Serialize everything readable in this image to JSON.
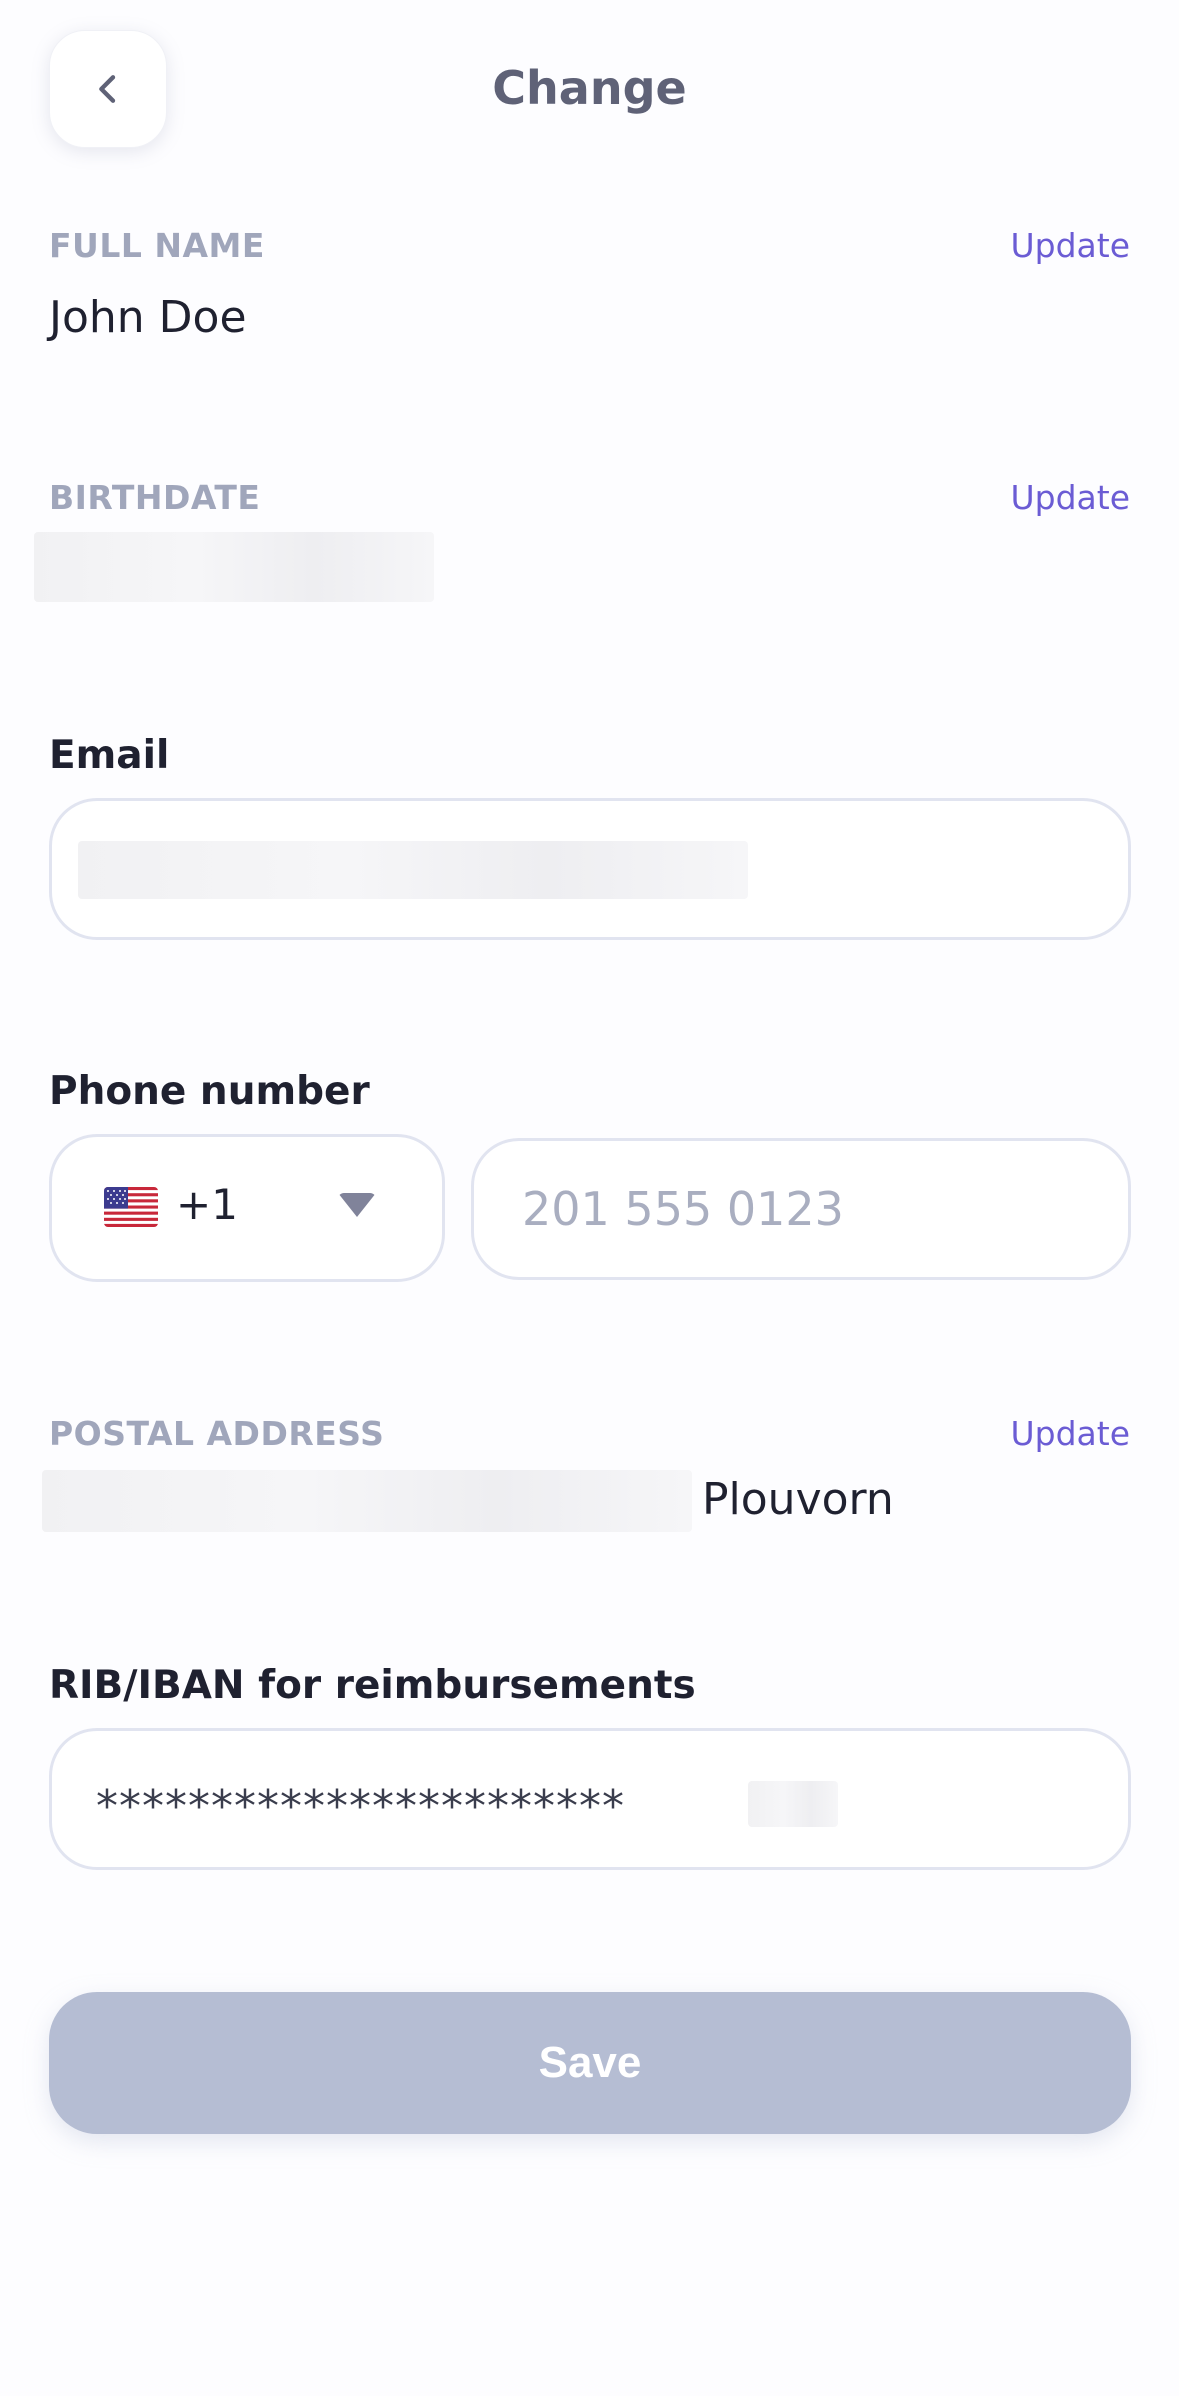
{
  "header": {
    "title": "Change",
    "back_icon": "chevron-left-icon"
  },
  "full_name": {
    "label": "FULL NAME",
    "update_label": "Update",
    "value": "John Doe"
  },
  "birthdate": {
    "label": "BIRTHDATE",
    "update_label": "Update"
  },
  "email": {
    "label": "Email"
  },
  "phone": {
    "label": "Phone number",
    "country_flag": "us-flag-icon",
    "dial_code": "+1",
    "placeholder": "201 555 0123"
  },
  "postal_address": {
    "label": "POSTAL ADDRESS",
    "update_label": "Update",
    "city": "Plouvorn"
  },
  "iban": {
    "label": "RIB/IBAN for reimbursements",
    "masked_value": "***********************"
  },
  "save": {
    "label": "Save"
  },
  "colors": {
    "accent": "#6b5cd4",
    "save_disabled": "#b5bdd3",
    "muted_label": "#a0a6bb"
  }
}
